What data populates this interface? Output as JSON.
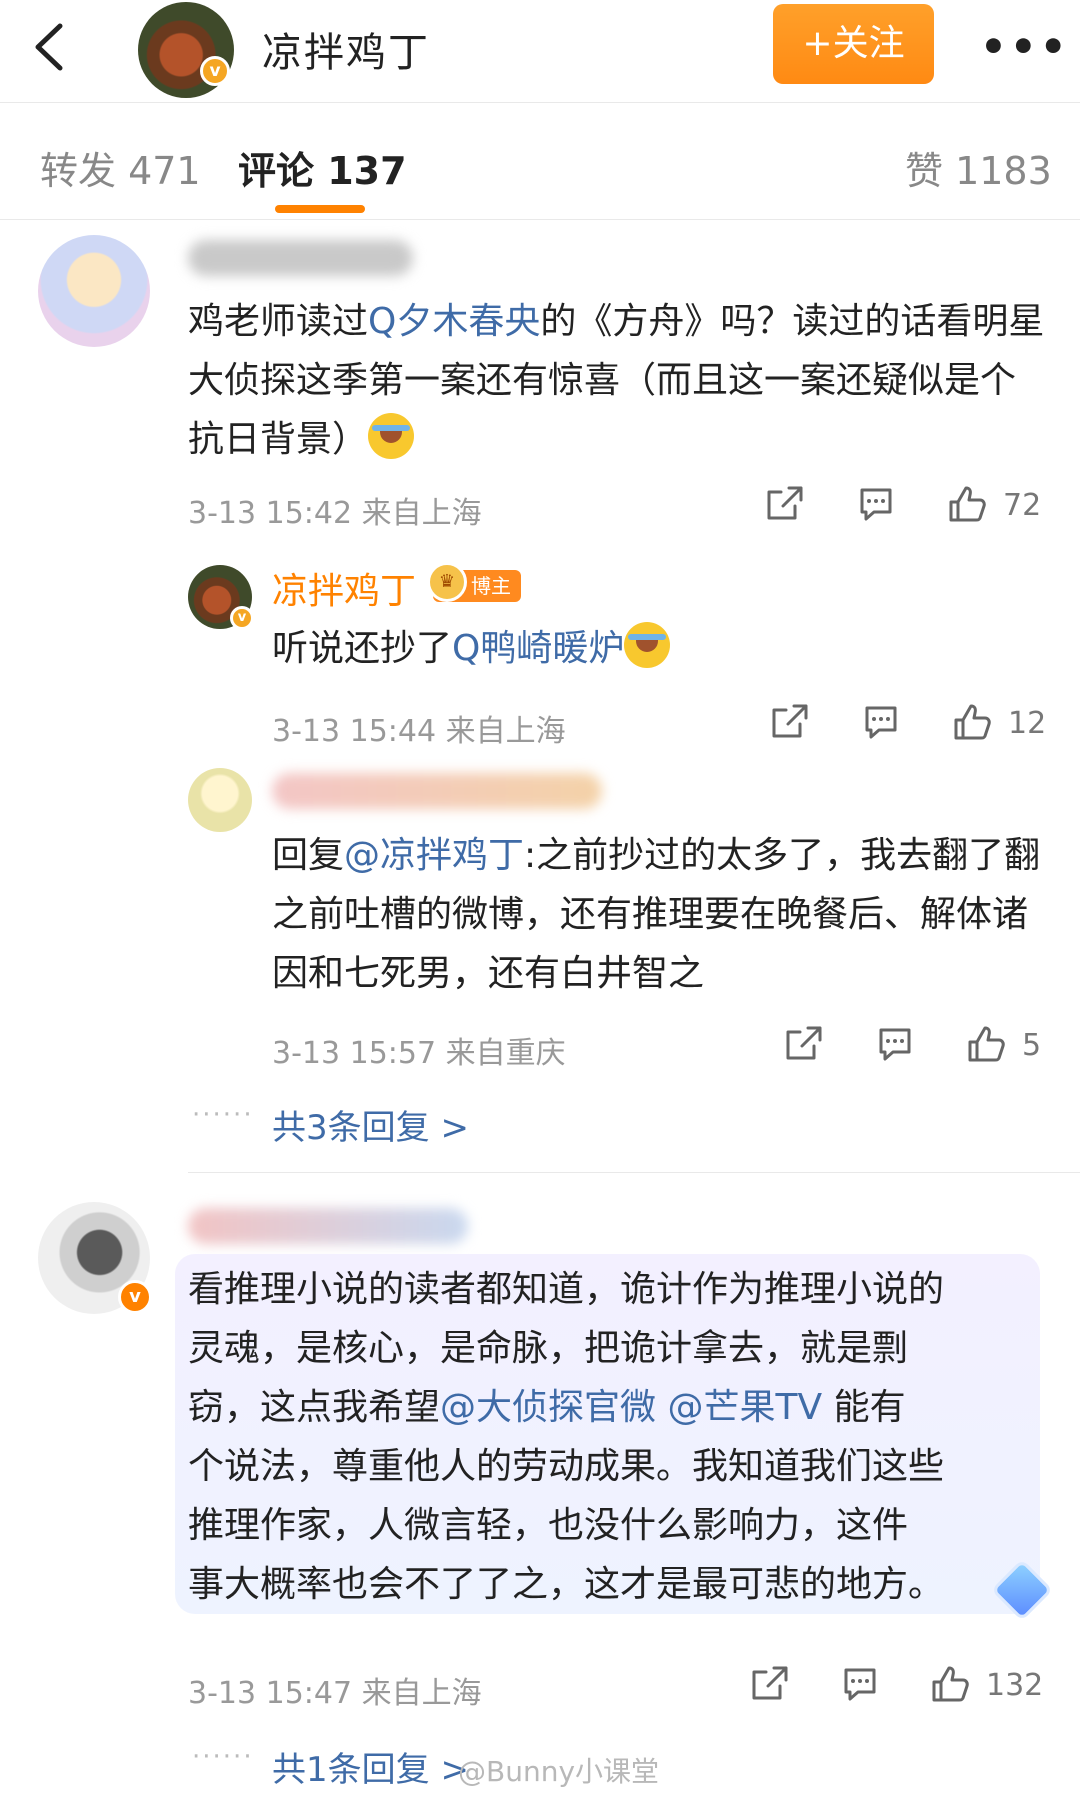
{
  "header": {
    "user_name": "凉拌鸡丁",
    "follow_label": "+关注",
    "more_label": "•••"
  },
  "tabs": [
    {
      "label": "转发 471"
    },
    {
      "label": "评论 137"
    },
    {
      "label": "赞 1183"
    }
  ],
  "comments": [
    {
      "text_before": "鸡老师读过",
      "mention": "Q夕木春央",
      "text_after": "的《方舟》吗？读过的话看明星大侦探这季第一案还有惊喜（而且这一案还疑似是个抗日背景）",
      "meta": "3-13 15:42 来自上海",
      "likes": "72",
      "replies": [
        {
          "name": "凉拌鸡丁",
          "tag": "博主",
          "text_before": "听说还抄了",
          "mention": "Q鸭崎暖炉",
          "meta": "3-13 15:44 来自上海",
          "likes": "12"
        },
        {
          "reply_prefix": "回复",
          "mention": "@凉拌鸡丁",
          "text_after": ":之前抄过的太多了，我去翻了翻之前吐槽的微博，还有推理要在晚餐后、解体诸因和七死男，还有白井智之",
          "meta": "3-13 15:57 来自重庆",
          "likes": "5"
        }
      ],
      "more_replies": "共3条回复 >"
    },
    {
      "line1": "看推理小说的读者都知道，诡计作为推理小说的",
      "line2": "灵魂，是核心，是命脉，把诡计拿去，就是剽",
      "line3_before": "窃，这点我希望",
      "mention1": "@大侦探官微",
      "mention2": "@芒果TV",
      "line3_after": "能有",
      "line4": "个说法，尊重他人的劳动成果。我知道我们这些",
      "line5": "推理作家，人微言轻，也没什么影响力，这件",
      "line6": "事大概率也会不了了之，这才是最可悲的地方。",
      "meta": "3-13 15:47 来自上海",
      "likes": "132",
      "more_replies": "共1条回复 >"
    }
  ],
  "watermark": "@Bunny小课堂",
  "colors": {
    "accent": "#ff8200",
    "link": "#3f6ba7",
    "follow": "#ff8a13"
  }
}
